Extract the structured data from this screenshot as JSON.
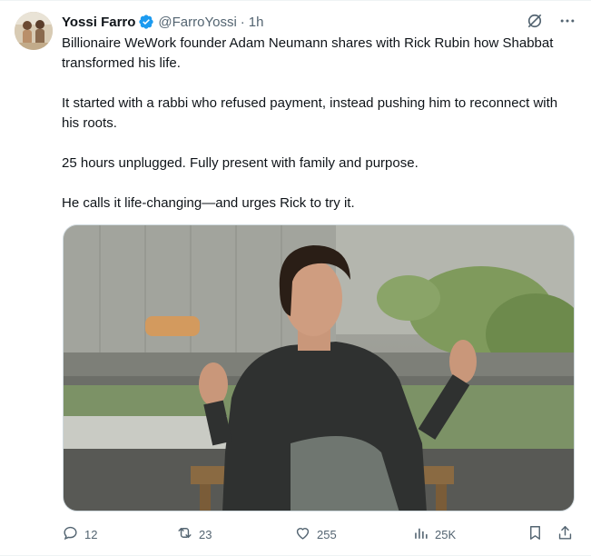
{
  "author": {
    "name": "Yossi Farro",
    "handle": "@FarroYossi",
    "separator": "·",
    "time": "1h"
  },
  "post": {
    "paragraphs": [
      "Billionaire WeWork founder Adam Neumann shares with Rick Rubin how Shabbat transformed his life.",
      "It started with a rabbi who refused payment, instead pushing him to reconnect with his roots.",
      "25 hours unplugged. Fully present with family and purpose.",
      "He calls it life-changing—and urges Rick to try it."
    ]
  },
  "engagement": {
    "replies": "12",
    "reposts": "23",
    "likes": "255",
    "views": "25K"
  },
  "colors": {
    "verified": "#1d9bf0",
    "secondary_text": "#536471",
    "primary_text": "#0f1419"
  },
  "icons": {
    "verified": "verified-badge-icon",
    "grok": "grok-icon",
    "more": "more-icon",
    "reply": "reply-icon",
    "repost": "repost-icon",
    "like": "like-icon",
    "views": "views-icon",
    "bookmark": "bookmark-icon",
    "share": "share-icon"
  }
}
